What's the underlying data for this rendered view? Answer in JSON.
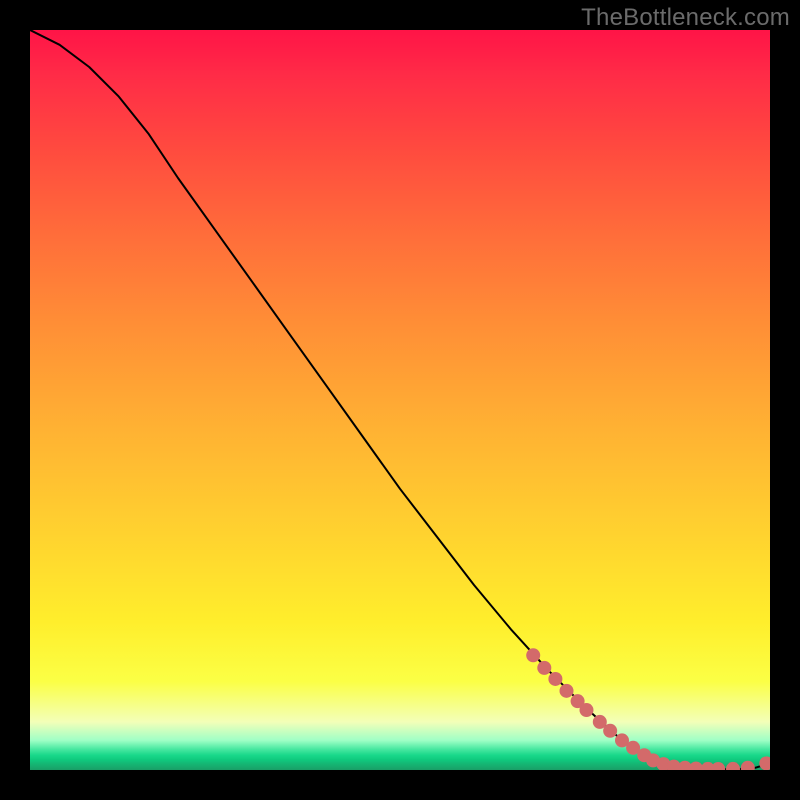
{
  "watermark": "TheBottleneck.com",
  "chart_data": {
    "type": "line",
    "title": "",
    "xlabel": "",
    "ylabel": "",
    "xlim": [
      0,
      100
    ],
    "ylim": [
      0,
      100
    ],
    "series": [
      {
        "name": "curve",
        "x": [
          0,
          4,
          8,
          12,
          16,
          20,
          25,
          30,
          35,
          40,
          45,
          50,
          55,
          60,
          65,
          70,
          75,
          80,
          83,
          86,
          88,
          90,
          92,
          94,
          96,
          98,
          100
        ],
        "y": [
          100,
          98,
          95,
          91,
          86,
          80,
          73,
          66,
          59,
          52,
          45,
          38,
          31.5,
          25,
          19,
          13.5,
          8.5,
          4,
          2,
          0.7,
          0.3,
          0.15,
          0.1,
          0.1,
          0.15,
          0.3,
          0.9
        ]
      }
    ],
    "markers": [
      {
        "x": 68,
        "y": 15.5
      },
      {
        "x": 69.5,
        "y": 13.8
      },
      {
        "x": 71,
        "y": 12.3
      },
      {
        "x": 72.5,
        "y": 10.7
      },
      {
        "x": 74,
        "y": 9.3
      },
      {
        "x": 75.2,
        "y": 8.1
      },
      {
        "x": 77,
        "y": 6.5
      },
      {
        "x": 78.4,
        "y": 5.3
      },
      {
        "x": 80,
        "y": 4.0
      },
      {
        "x": 81.5,
        "y": 3.0
      },
      {
        "x": 83,
        "y": 2.0
      },
      {
        "x": 84.2,
        "y": 1.3
      },
      {
        "x": 85.6,
        "y": 0.8
      },
      {
        "x": 87,
        "y": 0.45
      },
      {
        "x": 88.5,
        "y": 0.3
      },
      {
        "x": 90,
        "y": 0.2
      },
      {
        "x": 91.6,
        "y": 0.15
      },
      {
        "x": 93,
        "y": 0.13
      },
      {
        "x": 95,
        "y": 0.15
      },
      {
        "x": 97,
        "y": 0.3
      },
      {
        "x": 99.5,
        "y": 0.9
      }
    ],
    "marker_style": {
      "color": "#d36a6a",
      "radius_px": 7
    }
  }
}
